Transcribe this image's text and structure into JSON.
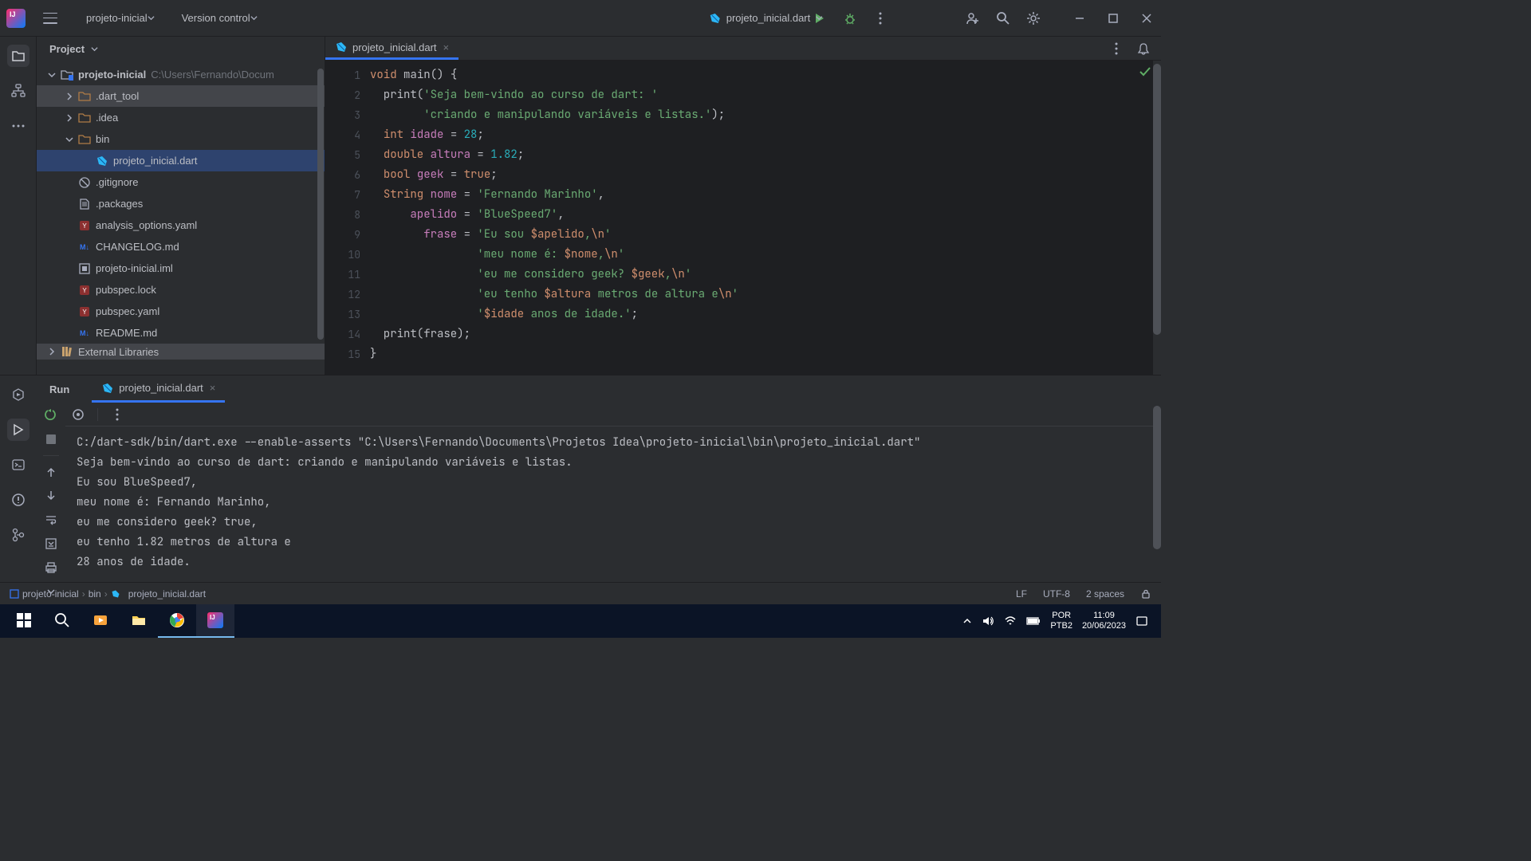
{
  "titlebar": {
    "project_menu": "projeto-inicial",
    "version_control": "Version control",
    "run_config": "projeto_inicial.dart"
  },
  "project_panel": {
    "title": "Project",
    "root": "projeto-inicial",
    "root_path": "C:\\Users\\Fernando\\Docum",
    "items": [
      {
        "name": ".dart_tool",
        "type": "folder"
      },
      {
        "name": ".idea",
        "type": "folder"
      },
      {
        "name": "bin",
        "type": "folder",
        "expanded": true,
        "children": [
          {
            "name": "projeto_inicial.dart",
            "type": "dart",
            "selected": true
          }
        ]
      },
      {
        "name": ".gitignore",
        "type": "git"
      },
      {
        "name": ".packages",
        "type": "file"
      },
      {
        "name": "analysis_options.yaml",
        "type": "yaml"
      },
      {
        "name": "CHANGELOG.md",
        "type": "md"
      },
      {
        "name": "projeto-inicial.iml",
        "type": "iml"
      },
      {
        "name": "pubspec.lock",
        "type": "yaml"
      },
      {
        "name": "pubspec.yaml",
        "type": "yaml"
      },
      {
        "name": "README.md",
        "type": "md"
      }
    ],
    "external": "External Libraries"
  },
  "editor": {
    "tab_name": "projeto_inicial.dart",
    "lines": [
      {
        "tokens": [
          {
            "t": "void",
            "c": "kw"
          },
          {
            "t": " "
          },
          {
            "t": "main",
            "c": "fn"
          },
          {
            "t": "() {"
          }
        ]
      },
      {
        "tokens": [
          {
            "t": "  print("
          },
          {
            "t": "'Seja bem-vindo ao curso de dart: '",
            "c": "str"
          }
        ]
      },
      {
        "tokens": [
          {
            "t": "        "
          },
          {
            "t": "'criando e manipulando variáveis e listas.'",
            "c": "str"
          },
          {
            "t": ");"
          }
        ]
      },
      {
        "tokens": [
          {
            "t": "  "
          },
          {
            "t": "int",
            "c": "kw"
          },
          {
            "t": " "
          },
          {
            "t": "idade",
            "c": "ident"
          },
          {
            "t": " = "
          },
          {
            "t": "28",
            "c": "num"
          },
          {
            "t": ";"
          }
        ]
      },
      {
        "tokens": [
          {
            "t": "  "
          },
          {
            "t": "double",
            "c": "kw"
          },
          {
            "t": " "
          },
          {
            "t": "altura",
            "c": "ident"
          },
          {
            "t": " = "
          },
          {
            "t": "1.82",
            "c": "num"
          },
          {
            "t": ";"
          }
        ]
      },
      {
        "tokens": [
          {
            "t": "  "
          },
          {
            "t": "bool",
            "c": "kw"
          },
          {
            "t": " "
          },
          {
            "t": "geek",
            "c": "ident"
          },
          {
            "t": " = "
          },
          {
            "t": "true",
            "c": "kw"
          },
          {
            "t": ";"
          }
        ]
      },
      {
        "tokens": [
          {
            "t": "  "
          },
          {
            "t": "String",
            "c": "kw"
          },
          {
            "t": " "
          },
          {
            "t": "nome",
            "c": "ident"
          },
          {
            "t": " = "
          },
          {
            "t": "'Fernando Marinho'",
            "c": "str"
          },
          {
            "t": ","
          }
        ]
      },
      {
        "tokens": [
          {
            "t": "      "
          },
          {
            "t": "apelido",
            "c": "ident"
          },
          {
            "t": " = "
          },
          {
            "t": "'BlueSpeed7'",
            "c": "str"
          },
          {
            "t": ","
          }
        ]
      },
      {
        "tokens": [
          {
            "t": "        "
          },
          {
            "t": "frase",
            "c": "ident"
          },
          {
            "t": " = "
          },
          {
            "t": "'Eu sou ",
            "c": "str"
          },
          {
            "t": "$apelido",
            "c": "kw"
          },
          {
            "t": ",",
            "c": "str"
          },
          {
            "t": "\\n",
            "c": "kw"
          },
          {
            "t": "'",
            "c": "str"
          }
        ]
      },
      {
        "tokens": [
          {
            "t": "                "
          },
          {
            "t": "'meu nome é: ",
            "c": "str"
          },
          {
            "t": "$nome",
            "c": "kw"
          },
          {
            "t": ",",
            "c": "str"
          },
          {
            "t": "\\n",
            "c": "kw"
          },
          {
            "t": "'",
            "c": "str"
          }
        ]
      },
      {
        "tokens": [
          {
            "t": "                "
          },
          {
            "t": "'eu me considero geek? ",
            "c": "str"
          },
          {
            "t": "$geek",
            "c": "kw"
          },
          {
            "t": ",",
            "c": "str"
          },
          {
            "t": "\\n",
            "c": "kw"
          },
          {
            "t": "'",
            "c": "str"
          }
        ]
      },
      {
        "tokens": [
          {
            "t": "                "
          },
          {
            "t": "'eu tenho ",
            "c": "str"
          },
          {
            "t": "$altura",
            "c": "kw"
          },
          {
            "t": " metros de altura e",
            "c": "str"
          },
          {
            "t": "\\n",
            "c": "kw"
          },
          {
            "t": "'",
            "c": "str"
          }
        ]
      },
      {
        "tokens": [
          {
            "t": "                "
          },
          {
            "t": "'",
            "c": "str"
          },
          {
            "t": "$idade",
            "c": "kw"
          },
          {
            "t": " anos de idade.'",
            "c": "str"
          },
          {
            "t": ";"
          }
        ]
      },
      {
        "tokens": [
          {
            "t": "  print(frase);"
          }
        ]
      },
      {
        "tokens": [
          {
            "t": "}"
          }
        ]
      }
    ]
  },
  "run": {
    "title": "Run",
    "tab_name": "projeto_inicial.dart",
    "console_lines": [
      "C:/dart-sdk/bin/dart.exe --enable-asserts \"C:\\Users\\Fernando\\Documents\\Projetos Idea\\projeto-inicial\\bin\\projeto_inicial.dart\"",
      "Seja bem-vindo ao curso de dart: criando e manipulando variáveis e listas.",
      "Eu sou BlueSpeed7,",
      "meu nome é: Fernando Marinho,",
      "eu me considero geek? true,",
      "eu tenho 1.82 metros de altura e",
      "28 anos de idade."
    ]
  },
  "status_bar": {
    "crumbs": [
      "projeto-inicial",
      "bin",
      "projeto_inicial.dart"
    ],
    "lf": "LF",
    "encoding": "UTF-8",
    "indent": "2 spaces"
  },
  "taskbar": {
    "lang": "POR",
    "kb": "PTB2",
    "time": "11:09",
    "date": "20/06/2023"
  }
}
